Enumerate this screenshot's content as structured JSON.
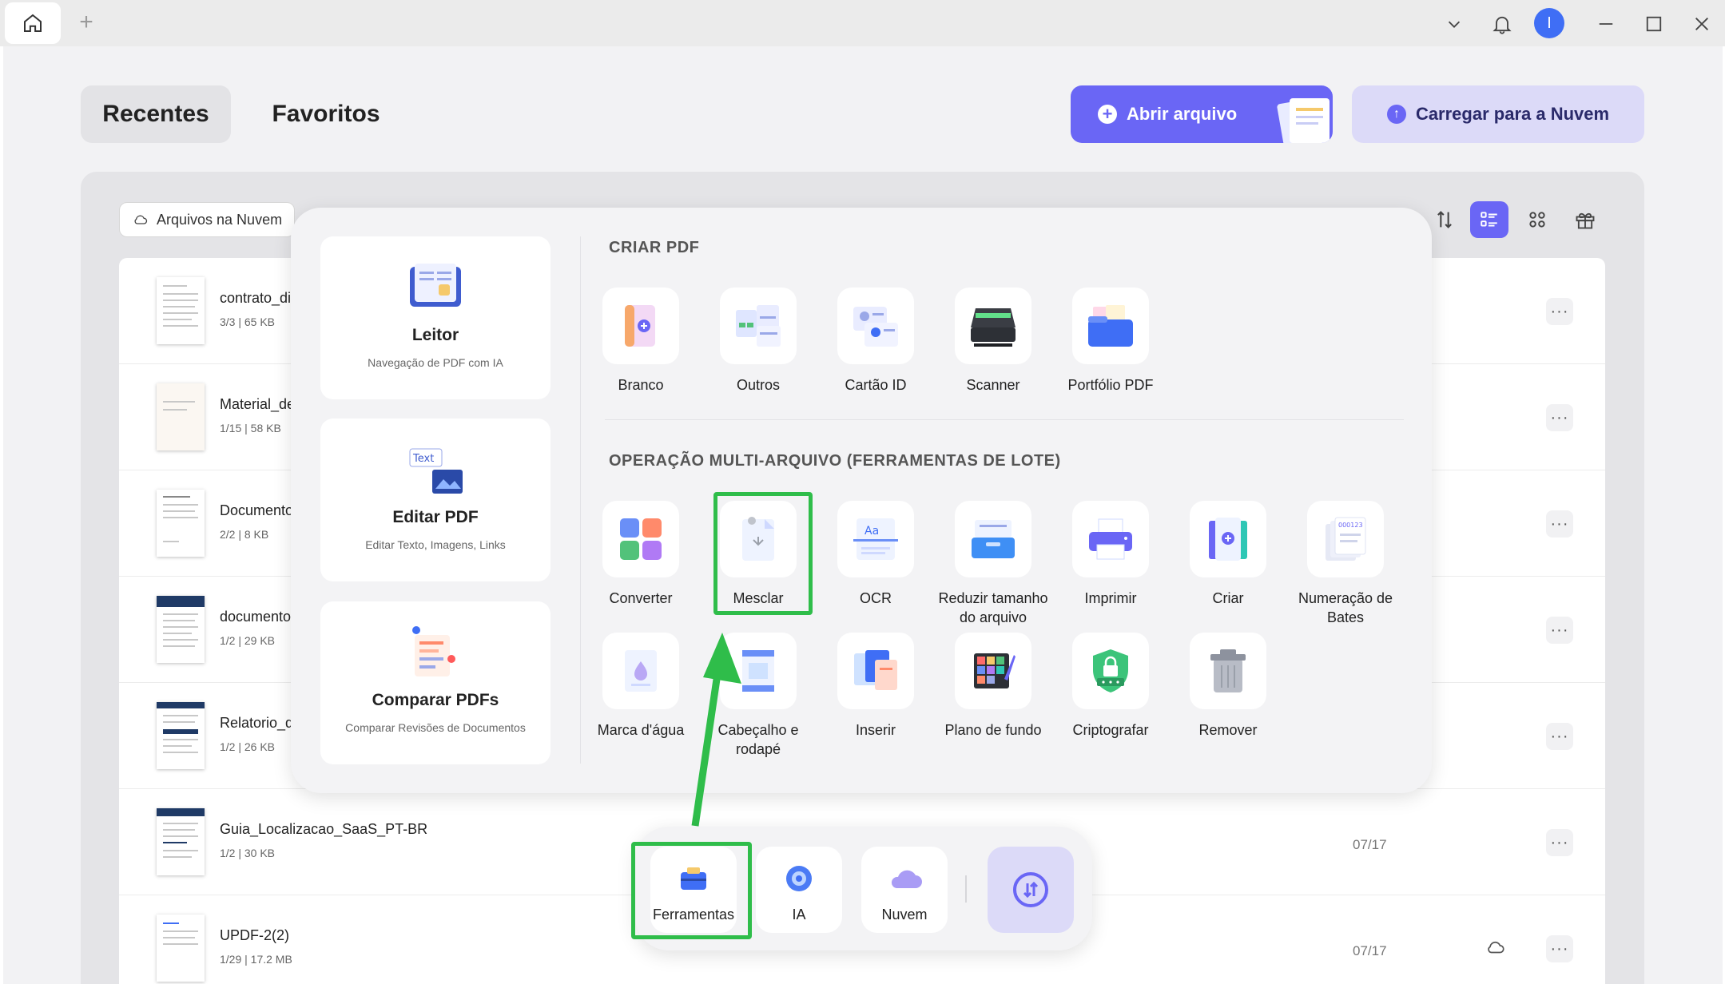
{
  "window": {
    "avatar_initial": "I"
  },
  "tabs": {
    "recent": "Recentes",
    "favorites": "Favoritos"
  },
  "actions": {
    "open_file": "Abrir arquivo",
    "upload_cloud": "Carregar para a Nuvem"
  },
  "filter": {
    "cloud_files": "Arquivos na Nuvem"
  },
  "files": [
    {
      "name": "contrato_di",
      "meta": "3/3 | 65 KB",
      "date": ""
    },
    {
      "name": "Material_de",
      "meta": "1/15 | 58 KB",
      "date": ""
    },
    {
      "name": "Documento",
      "meta": "2/2 | 8 KB",
      "date": ""
    },
    {
      "name": "documento",
      "meta": "1/2 | 29 KB",
      "date": ""
    },
    {
      "name": "Relatorio_d",
      "meta": "1/2 | 26 KB",
      "date": ""
    },
    {
      "name": "Guia_Localizacao_SaaS_PT-BR",
      "meta": "1/2 | 30 KB",
      "date": "07/17"
    },
    {
      "name": "UPDF-2(2)",
      "meta": "1/29 | 17.2 MB",
      "date": "07/17"
    }
  ],
  "side_cards": [
    {
      "title": "Leitor",
      "subtitle": "Navegação de PDF com IA"
    },
    {
      "title": "Editar PDF",
      "subtitle": "Editar Texto, Imagens, Links"
    },
    {
      "title": "Comparar PDFs",
      "subtitle": "Comparar Revisões de Documentos"
    }
  ],
  "create_pdf": {
    "title": "CRIAR PDF",
    "items": [
      "Branco",
      "Outros",
      "Cartão ID",
      "Scanner",
      "Portfólio PDF"
    ]
  },
  "batch": {
    "title": "OPERAÇÃO MULTI-ARQUIVO (FERRAMENTAS DE LOTE)",
    "row1": [
      "Converter",
      "Mesclar",
      "OCR",
      "Reduzir tamanho do arquivo",
      "Imprimir",
      "Criar",
      "Numeração de Bates"
    ],
    "row2": [
      "Marca d'água",
      "Cabeçalho e rodapé",
      "Inserir",
      "Plano de fundo",
      "Criptografar",
      "Remover"
    ]
  },
  "dock": {
    "tools": "Ferramentas",
    "ai": "IA",
    "cloud": "Nuvem"
  },
  "colors": {
    "accent": "#6a66f5",
    "highlight": "#2fbd4a"
  }
}
